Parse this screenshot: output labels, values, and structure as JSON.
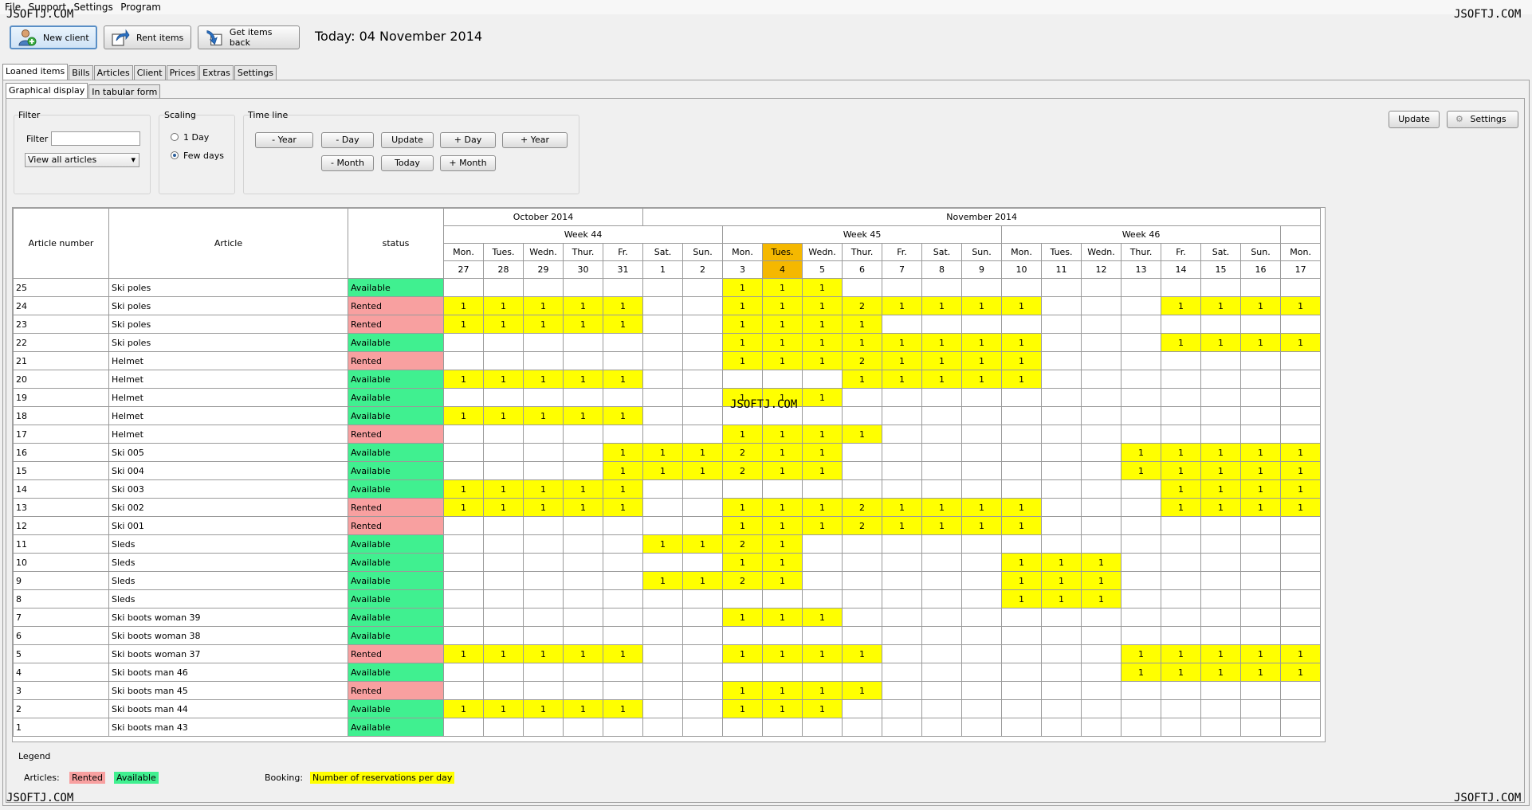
{
  "menu": [
    "File",
    "Support",
    "Settings",
    "Program"
  ],
  "watermark": "JSOFTJ.COM",
  "toolbar": {
    "new_client": "New client",
    "rent_items": "Rent items",
    "get_items_back": "Get items back",
    "today_label": "Today: 04 November 2014"
  },
  "main_tabs": [
    "Loaned items",
    "Bills",
    "Articles",
    "Client",
    "Prices",
    "Extras",
    "Settings"
  ],
  "sub_tabs": [
    "Graphical display",
    "In tabular form"
  ],
  "filter": {
    "group_title": "Filter",
    "filter_label": "Filter",
    "filter_value": "",
    "select_value": "View all articles"
  },
  "scaling": {
    "group_title": "Scaling",
    "option_1day": "1 Day",
    "option_fewdays": "Few days",
    "selected": "Few days"
  },
  "timeline": {
    "group_title": "Time line",
    "minus_year": "- Year",
    "minus_day": "- Day",
    "update": "Update",
    "plus_day": "+ Day",
    "plus_year": "+ Year",
    "minus_month": "- Month",
    "today": "Today",
    "plus_month": "+ Month"
  },
  "right_buttons": {
    "update": "Update",
    "settings": "Settings"
  },
  "grid": {
    "headers": {
      "article_number": "Article number",
      "article": "Article",
      "status": "status"
    },
    "months": [
      {
        "label": "October 2014",
        "span": 5
      },
      {
        "label": "November 2014",
        "span": 17
      }
    ],
    "weeks": [
      {
        "label": "Week 44",
        "span": 7
      },
      {
        "label": "Week 45",
        "span": 7
      },
      {
        "label": "Week 46",
        "span": 7
      },
      {
        "label": "",
        "span": 1
      }
    ],
    "days": [
      {
        "wd": "Mon.",
        "d": "27"
      },
      {
        "wd": "Tues.",
        "d": "28"
      },
      {
        "wd": "Wedn.",
        "d": "29"
      },
      {
        "wd": "Thur.",
        "d": "30"
      },
      {
        "wd": "Fr.",
        "d": "31"
      },
      {
        "wd": "Sat.",
        "d": "1"
      },
      {
        "wd": "Sun.",
        "d": "2"
      },
      {
        "wd": "Mon.",
        "d": "3"
      },
      {
        "wd": "Tues.",
        "d": "4"
      },
      {
        "wd": "Wedn.",
        "d": "5"
      },
      {
        "wd": "Thur.",
        "d": "6"
      },
      {
        "wd": "Fr.",
        "d": "7"
      },
      {
        "wd": "Sat.",
        "d": "8"
      },
      {
        "wd": "Sun.",
        "d": "9"
      },
      {
        "wd": "Mon.",
        "d": "10"
      },
      {
        "wd": "Tues.",
        "d": "11"
      },
      {
        "wd": "Wedn.",
        "d": "12"
      },
      {
        "wd": "Thur.",
        "d": "13"
      },
      {
        "wd": "Fr.",
        "d": "14"
      },
      {
        "wd": "Sat.",
        "d": "15"
      },
      {
        "wd": "Sun.",
        "d": "16"
      },
      {
        "wd": "Mon.",
        "d": "17"
      }
    ],
    "today_day": "4",
    "rows": [
      {
        "num": "25",
        "article": "Ski poles",
        "status": "Available",
        "cells": [
          "",
          "",
          "",
          "",
          "",
          "",
          "",
          "1",
          "1",
          "1",
          "",
          "",
          "",
          "",
          "",
          "",
          "",
          "",
          "",
          "",
          "",
          ""
        ]
      },
      {
        "num": "24",
        "article": "Ski poles",
        "status": "Rented",
        "cells": [
          "1",
          "1",
          "1",
          "1",
          "1",
          "",
          "",
          "1",
          "1",
          "1",
          "2",
          "1",
          "1",
          "1",
          "1",
          "",
          "",
          "",
          "1",
          "1",
          "1",
          "1"
        ]
      },
      {
        "num": "23",
        "article": "Ski poles",
        "status": "Rented",
        "cells": [
          "1",
          "1",
          "1",
          "1",
          "1",
          "",
          "",
          "1",
          "1",
          "1",
          "1",
          "",
          "",
          "",
          "",
          "",
          "",
          "",
          "",
          "",
          "",
          ""
        ]
      },
      {
        "num": "22",
        "article": "Ski poles",
        "status": "Available",
        "cells": [
          "",
          "",
          "",
          "",
          "",
          "",
          "",
          "1",
          "1",
          "1",
          "1",
          "1",
          "1",
          "1",
          "1",
          "",
          "",
          "",
          "1",
          "1",
          "1",
          "1"
        ]
      },
      {
        "num": "21",
        "article": "Helmet",
        "status": "Rented",
        "cells": [
          "",
          "",
          "",
          "",
          "",
          "",
          "",
          "1",
          "1",
          "1",
          "2",
          "1",
          "1",
          "1",
          "1",
          "",
          "",
          "",
          "",
          "",
          "",
          ""
        ]
      },
      {
        "num": "20",
        "article": "Helmet",
        "status": "Available",
        "cells": [
          "1",
          "1",
          "1",
          "1",
          "1",
          "",
          "",
          "",
          "",
          "",
          "1",
          "1",
          "1",
          "1",
          "1",
          "",
          "",
          "",
          "",
          "",
          "",
          ""
        ]
      },
      {
        "num": "19",
        "article": "Helmet",
        "status": "Available",
        "cells": [
          "",
          "",
          "",
          "",
          "",
          "",
          "",
          "1",
          "1",
          "1",
          "",
          "",
          "",
          "",
          "",
          "",
          "",
          "",
          "",
          "",
          "",
          ""
        ]
      },
      {
        "num": "18",
        "article": "Helmet",
        "status": "Available",
        "cells": [
          "1",
          "1",
          "1",
          "1",
          "1",
          "",
          "",
          "",
          "",
          "",
          "",
          "",
          "",
          "",
          "",
          "",
          "",
          "",
          "",
          "",
          "",
          ""
        ]
      },
      {
        "num": "17",
        "article": "Helmet",
        "status": "Rented",
        "cells": [
          "",
          "",
          "",
          "",
          "",
          "",
          "",
          "1",
          "1",
          "1",
          "1",
          "",
          "",
          "",
          "",
          "",
          "",
          "",
          "",
          "",
          "",
          ""
        ]
      },
      {
        "num": "16",
        "article": "Ski 005",
        "status": "Available",
        "cells": [
          "",
          "",
          "",
          "",
          "1",
          "1",
          "1",
          "2",
          "1",
          "1",
          "",
          "",
          "",
          "",
          "",
          "",
          "",
          "1",
          "1",
          "1",
          "1",
          "1"
        ]
      },
      {
        "num": "15",
        "article": "Ski 004",
        "status": "Available",
        "cells": [
          "",
          "",
          "",
          "",
          "1",
          "1",
          "1",
          "2",
          "1",
          "1",
          "",
          "",
          "",
          "",
          "",
          "",
          "",
          "1",
          "1",
          "1",
          "1",
          "1"
        ]
      },
      {
        "num": "14",
        "article": "Ski 003",
        "status": "Available",
        "cells": [
          "1",
          "1",
          "1",
          "1",
          "1",
          "",
          "",
          "",
          "",
          "",
          "",
          "",
          "",
          "",
          "",
          "",
          "",
          "",
          "1",
          "1",
          "1",
          "1"
        ]
      },
      {
        "num": "13",
        "article": "Ski 002",
        "status": "Rented",
        "cells": [
          "1",
          "1",
          "1",
          "1",
          "1",
          "",
          "",
          "1",
          "1",
          "1",
          "2",
          "1",
          "1",
          "1",
          "1",
          "",
          "",
          "",
          "1",
          "1",
          "1",
          "1"
        ]
      },
      {
        "num": "12",
        "article": "Ski 001",
        "status": "Rented",
        "cells": [
          "",
          "",
          "",
          "",
          "",
          "",
          "",
          "1",
          "1",
          "1",
          "2",
          "1",
          "1",
          "1",
          "1",
          "",
          "",
          "",
          "",
          "",
          "",
          ""
        ]
      },
      {
        "num": "11",
        "article": "Sleds",
        "status": "Available",
        "cells": [
          "",
          "",
          "",
          "",
          "",
          "1",
          "1",
          "2",
          "1",
          "",
          "",
          "",
          "",
          "",
          "",
          "",
          "",
          "",
          "",
          "",
          "",
          ""
        ]
      },
      {
        "num": "10",
        "article": "Sleds",
        "status": "Available",
        "cells": [
          "",
          "",
          "",
          "",
          "",
          "",
          "",
          "1",
          "1",
          "",
          "",
          "",
          "",
          "",
          "1",
          "1",
          "1",
          "",
          "",
          "",
          "",
          ""
        ]
      },
      {
        "num": "9",
        "article": "Sleds",
        "status": "Available",
        "cells": [
          "",
          "",
          "",
          "",
          "",
          "1",
          "1",
          "2",
          "1",
          "",
          "",
          "",
          "",
          "",
          "1",
          "1",
          "1",
          "",
          "",
          "",
          "",
          ""
        ]
      },
      {
        "num": "8",
        "article": "Sleds",
        "status": "Available",
        "cells": [
          "",
          "",
          "",
          "",
          "",
          "",
          "",
          "",
          "",
          "",
          "",
          "",
          "",
          "",
          "1",
          "1",
          "1",
          "",
          "",
          "",
          "",
          ""
        ]
      },
      {
        "num": "7",
        "article": "Ski boots woman 39",
        "status": "Available",
        "cells": [
          "",
          "",
          "",
          "",
          "",
          "",
          "",
          "1",
          "1",
          "1",
          "",
          "",
          "",
          "",
          "",
          "",
          "",
          "",
          "",
          "",
          "",
          ""
        ]
      },
      {
        "num": "6",
        "article": "Ski boots woman 38",
        "status": "Available",
        "cells": [
          "",
          "",
          "",
          "",
          "",
          "",
          "",
          "",
          "",
          "",
          "",
          "",
          "",
          "",
          "",
          "",
          "",
          "",
          "",
          "",
          "",
          ""
        ]
      },
      {
        "num": "5",
        "article": "Ski boots woman 37",
        "status": "Rented",
        "cells": [
          "1",
          "1",
          "1",
          "1",
          "1",
          "",
          "",
          "1",
          "1",
          "1",
          "1",
          "",
          "",
          "",
          "",
          "",
          "",
          "1",
          "1",
          "1",
          "1",
          "1"
        ]
      },
      {
        "num": "4",
        "article": "Ski boots man 46",
        "status": "Available",
        "cells": [
          "",
          "",
          "",
          "",
          "",
          "",
          "",
          "",
          "",
          "",
          "",
          "",
          "",
          "",
          "",
          "",
          "",
          "1",
          "1",
          "1",
          "1",
          "1"
        ]
      },
      {
        "num": "3",
        "article": "Ski boots man 45",
        "status": "Rented",
        "cells": [
          "",
          "",
          "",
          "",
          "",
          "",
          "",
          "1",
          "1",
          "1",
          "1",
          "",
          "",
          "",
          "",
          "",
          "",
          "",
          "",
          "",
          "",
          ""
        ]
      },
      {
        "num": "2",
        "article": "Ski boots man 44",
        "status": "Available",
        "cells": [
          "1",
          "1",
          "1",
          "1",
          "1",
          "",
          "",
          "1",
          "1",
          "1",
          "",
          "",
          "",
          "",
          "",
          "",
          "",
          "",
          "",
          "",
          "",
          ""
        ]
      },
      {
        "num": "1",
        "article": "Ski boots man 43",
        "status": "Available",
        "cells": [
          "",
          "",
          "",
          "",
          "",
          "",
          "",
          "",
          "",
          "",
          "",
          "",
          "",
          "",
          "",
          "",
          "",
          "",
          "",
          "",
          "",
          ""
        ]
      }
    ]
  },
  "legend": {
    "title": "Legend",
    "articles_label": "Articles:",
    "rented": "Rented",
    "available": "Available",
    "booking_label": "Booking:",
    "booking_desc": "Number of reservations per day"
  },
  "colors": {
    "rented": "#f8a0a0",
    "available": "#40f090",
    "reservation": "#ffff00",
    "today_header": "#f5b800"
  }
}
